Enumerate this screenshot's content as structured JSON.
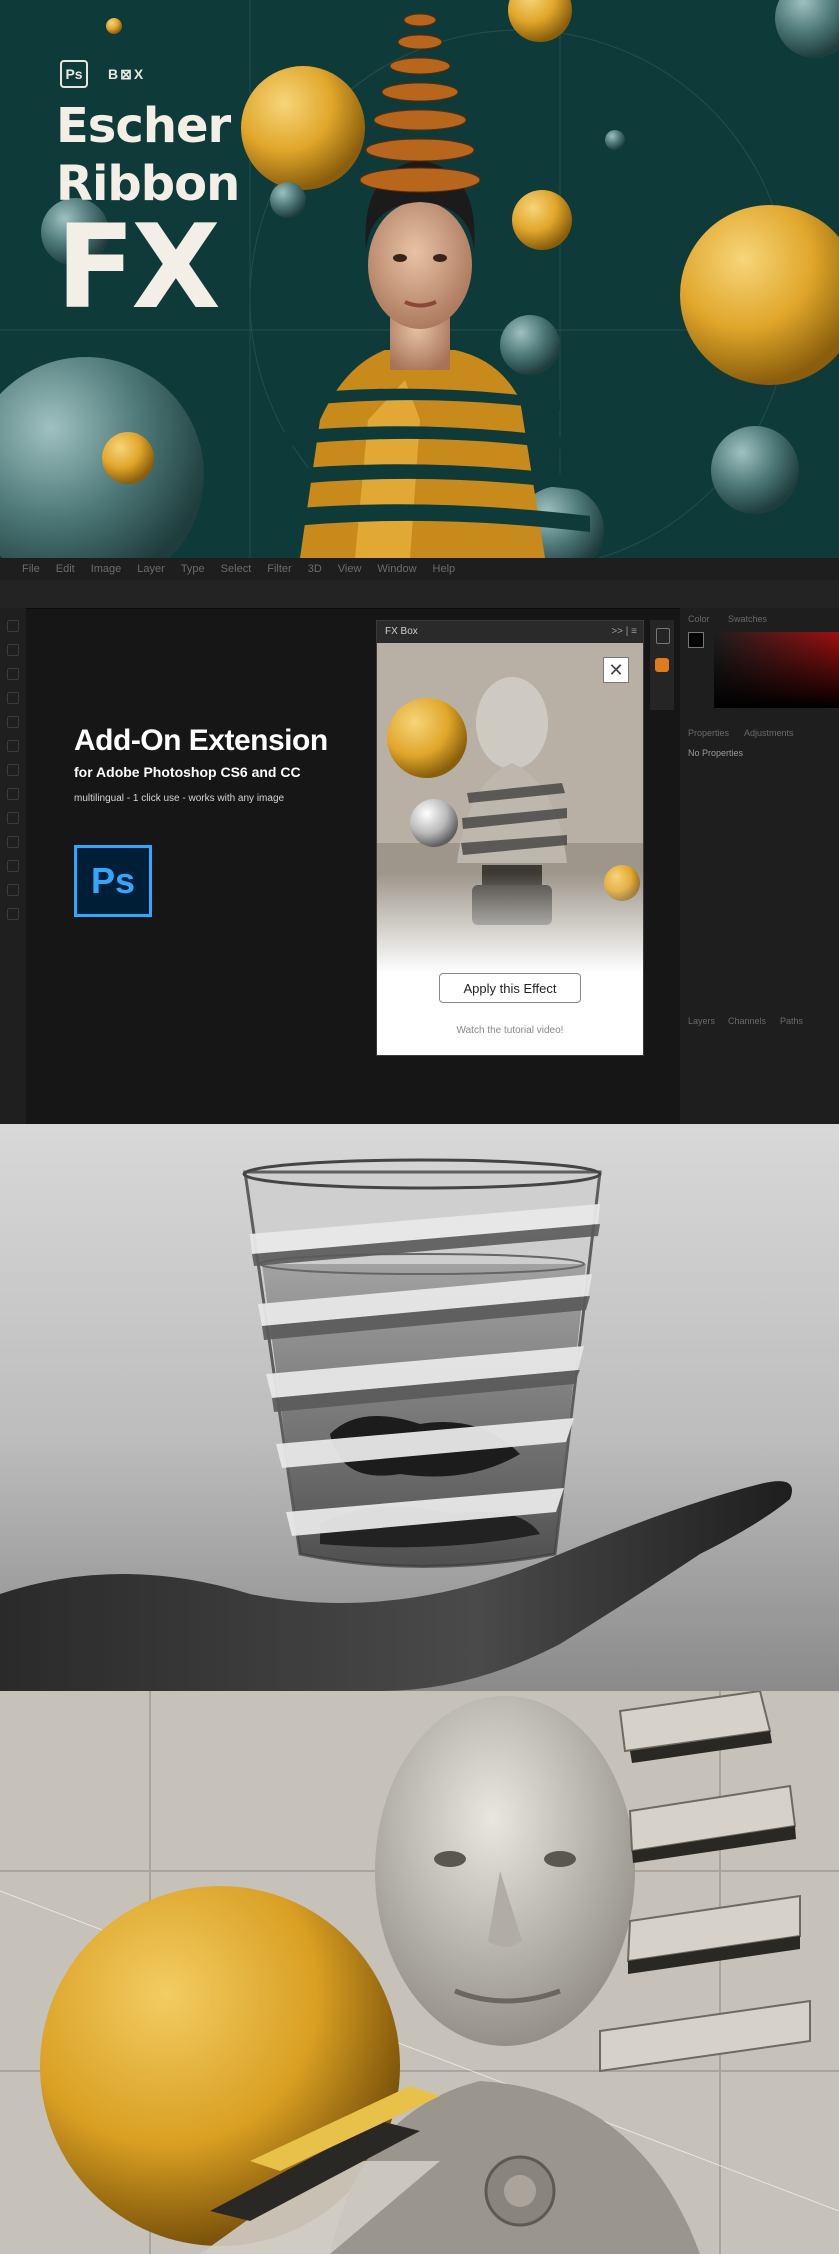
{
  "hero": {
    "ps_badge": "Ps",
    "brand_logo": "B⊠X",
    "title_line1": "Escher",
    "title_line2": "Ribbon",
    "title_line3": "FX"
  },
  "photoshop": {
    "menu": [
      "File",
      "Edit",
      "Image",
      "Layer",
      "Type",
      "Select",
      "Filter",
      "3D",
      "View",
      "Window",
      "Help"
    ],
    "headline": "Add-On Extension",
    "subline": "for Adobe Photoshop CS6 and CC",
    "tagline": "multilingual - 1 click use - works with any image",
    "ps_logo": "Ps",
    "panel": {
      "title": "FX Box",
      "controls": ">> | ≡",
      "close": "✕",
      "apply_button": "Apply this Effect",
      "tutorial_link": "Watch the tutorial video!"
    },
    "right_tabs": {
      "color": "Color",
      "swatches": "Swatches",
      "properties": "Properties",
      "adjustments": "Adjustments",
      "no_properties": "No Properties",
      "layers": "Layers",
      "channels": "Channels",
      "paths": "Paths"
    }
  },
  "colors": {
    "hero_bg": "#0f3a3a",
    "gold": "#e0a62a",
    "teal_sphere": "#4e7878",
    "ps_blue": "#31a8ff"
  }
}
